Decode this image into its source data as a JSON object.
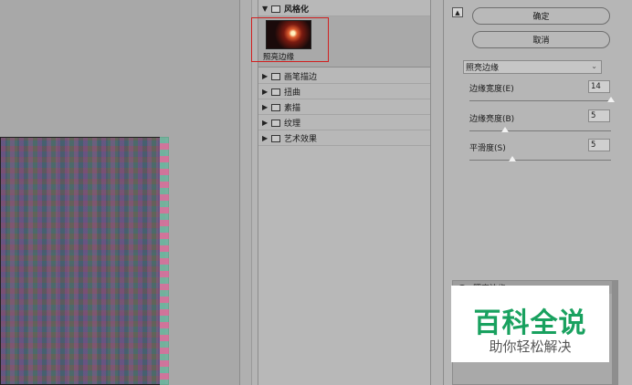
{
  "gallery": {
    "open_category": "风格化",
    "selected_filter_label": "照亮边缘",
    "folders": [
      {
        "label": "画笔描边"
      },
      {
        "label": "扭曲"
      },
      {
        "label": "素描"
      },
      {
        "label": "纹理"
      },
      {
        "label": "艺术效果"
      }
    ]
  },
  "buttons": {
    "ok": "确定",
    "cancel": "取消"
  },
  "settings": {
    "filter_select": "照亮边缘",
    "params": [
      {
        "label": "边缘宽度(E)",
        "value": "14",
        "slider": 1.0
      },
      {
        "label": "边缘亮度(B)",
        "value": "5",
        "slider": 0.25
      },
      {
        "label": "平滑度(S)",
        "value": "5",
        "slider": 0.3
      }
    ]
  },
  "layers": {
    "row_label": "照亮边缘"
  },
  "watermark": {
    "title": "百科全说",
    "subtitle": "助你轻松解决"
  },
  "icons": {
    "collapse": "collapse-up-icon",
    "folder": "folder-icon",
    "expand_arrow": "triangle-right-icon",
    "open_arrow": "triangle-down-icon",
    "eye": "eye-icon"
  }
}
